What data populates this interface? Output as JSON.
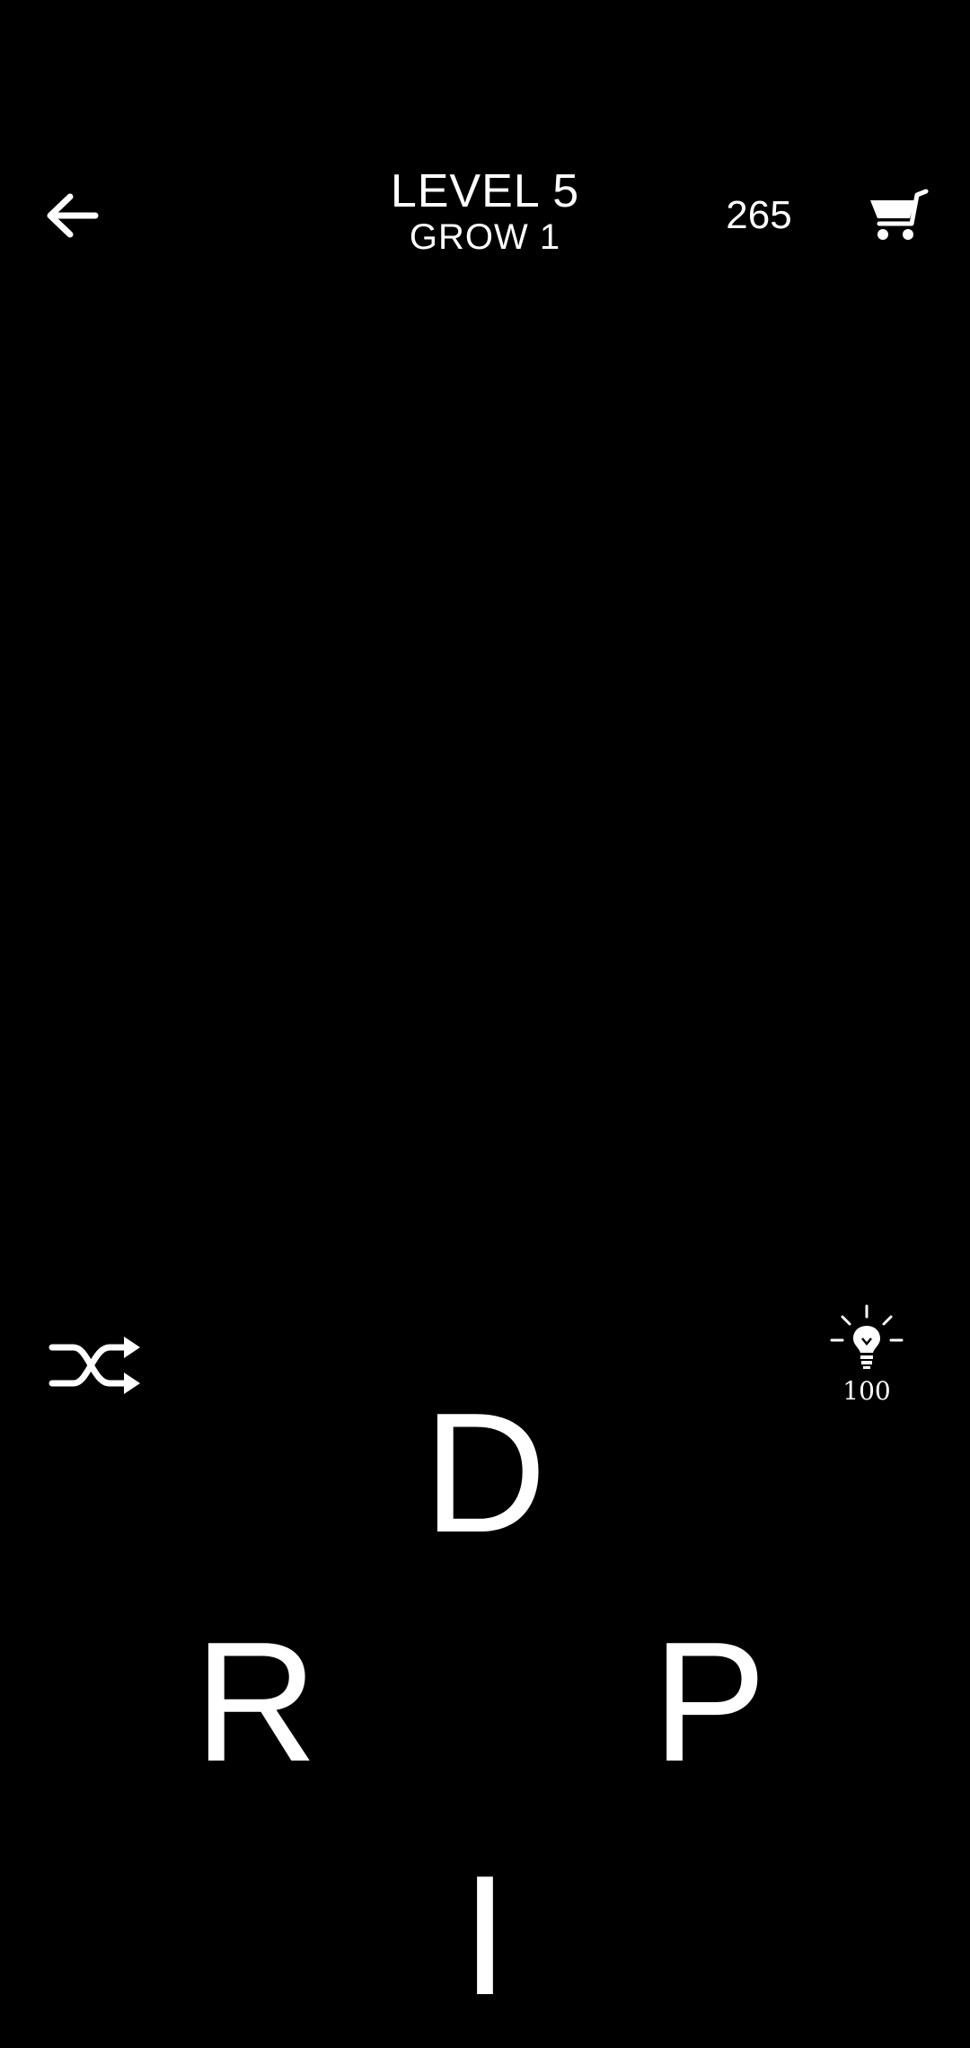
{
  "header": {
    "level_title": "LEVEL 5",
    "level_subtitle": "GROW 1",
    "coins": "265",
    "back_icon": "back-arrow-icon",
    "cart_icon": "shopping-cart-icon"
  },
  "tools": {
    "shuffle_icon": "shuffle-icon",
    "hint_icon": "lightbulb-icon",
    "hint_cost": "100"
  },
  "wheel": {
    "letters": [
      "D",
      "R",
      "P",
      "I"
    ]
  },
  "colors": {
    "background": "#000000",
    "foreground": "#ffffff"
  }
}
